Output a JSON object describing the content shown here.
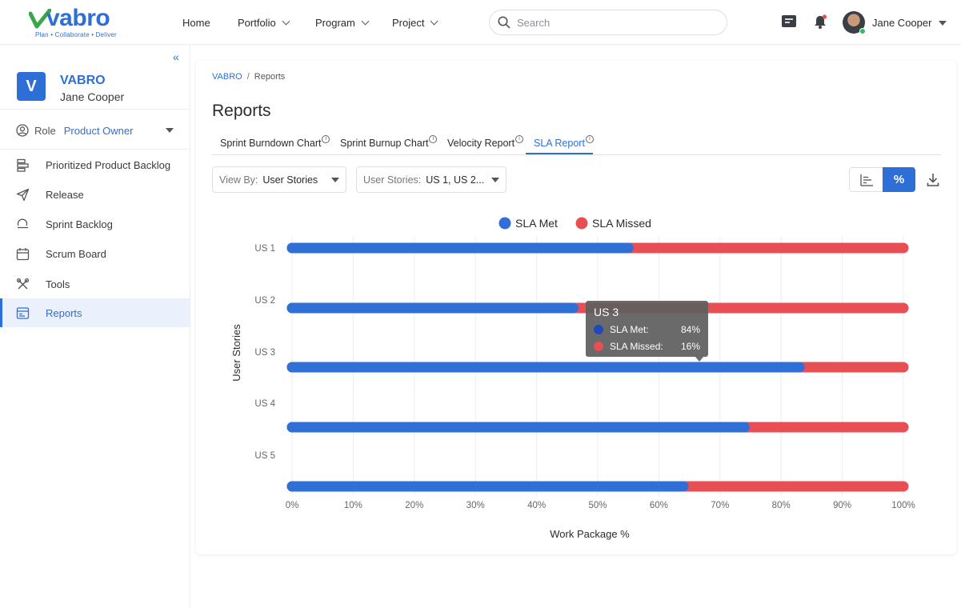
{
  "brand": {
    "name": "vabro",
    "tagline": "Plan • Collaborate • Deliver",
    "accent": "#2d6fd6",
    "logo_green": "#3aa64c"
  },
  "topnav": {
    "items": [
      {
        "label": "Home",
        "has_caret": false
      },
      {
        "label": "Portfolio",
        "has_caret": true
      },
      {
        "label": "Program",
        "has_caret": true
      },
      {
        "label": "Project",
        "has_caret": true
      }
    ],
    "search_placeholder": "Search",
    "icons": [
      "inbox-icon",
      "bell-icon"
    ],
    "user_name": "Jane Cooper"
  },
  "sidebar": {
    "project_initial": "V",
    "project_name": "VABRO",
    "project_user": "Jane Cooper",
    "role_label": "Role",
    "role_value": "Product Owner",
    "items": [
      {
        "label": "Prioritized Product Backlog",
        "icon": "backlog-icon",
        "active": false
      },
      {
        "label": "Release",
        "icon": "paper-plane-icon",
        "active": false
      },
      {
        "label": "Sprint Backlog",
        "icon": "sprint-icon",
        "active": false
      },
      {
        "label": "Scrum Board",
        "icon": "calendar-icon",
        "active": false
      },
      {
        "label": "Tools",
        "icon": "tools-icon",
        "active": false
      },
      {
        "label": "Reports",
        "icon": "report-icon",
        "active": true
      }
    ]
  },
  "breadcrumb": {
    "root": "VABRO",
    "separator": "/",
    "current": "Reports"
  },
  "page": {
    "title": "Reports",
    "tabs": [
      {
        "label": "Sprint Burndown Chart",
        "active": false
      },
      {
        "label": "Sprint Burnup Chart",
        "active": false
      },
      {
        "label": "Velocity Report",
        "active": false
      },
      {
        "label": "SLA Report",
        "active": true
      }
    ],
    "view_by_label": "View By:",
    "view_by_value": "User Stories",
    "user_stories_label": "User Stories:",
    "user_stories_value": "US 1, US 2...",
    "toggle_percent_label": "%"
  },
  "chart_data": {
    "type": "bar",
    "orientation": "horizontal",
    "stacked": true,
    "categories": [
      "US 1",
      "US 2",
      "US 3",
      "US 4",
      "US 5"
    ],
    "series": [
      {
        "name": "SLA Met",
        "color": "#2f6fd6",
        "values": [
          55,
          46,
          83,
          74,
          64
        ]
      },
      {
        "name": "SLA Missed",
        "color": "#e84f55",
        "values": [
          45,
          54,
          17,
          26,
          36
        ]
      }
    ],
    "xlabel": "Work Package %",
    "ylabel": "User Stories",
    "xlim": [
      0,
      100
    ],
    "xticks": [
      "0%",
      "10%",
      "20%",
      "30%",
      "40%",
      "50%",
      "60%",
      "70%",
      "80%",
      "90%",
      "100%"
    ],
    "legend_position": "top-center",
    "grid": "vertical"
  },
  "tooltip": {
    "title": "US 3",
    "rows": [
      {
        "label": "SLA Met:",
        "value": "84%",
        "color": "#1f48b8"
      },
      {
        "label": "SLA Missed:",
        "value": "16%",
        "color": "#e84f55"
      }
    ]
  }
}
